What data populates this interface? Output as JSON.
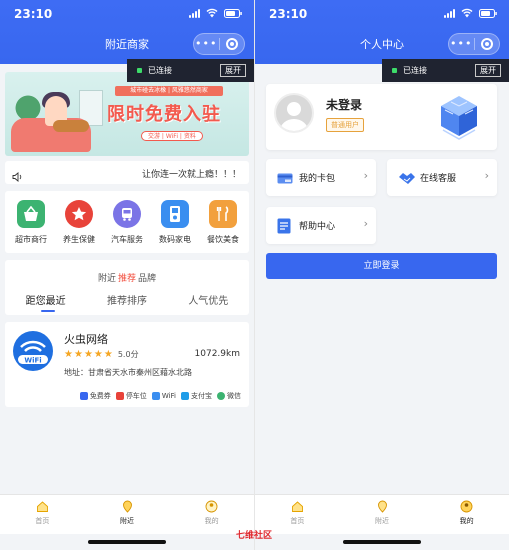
{
  "left": {
    "status_time": "23:10",
    "nav_title": "附近商家",
    "connection": {
      "text": "已连接",
      "expand": "展开"
    },
    "banner": {
      "ribbon": "城市碰去冰橡 | 风雅悠然商家",
      "title": "限时免费入驻",
      "tag": "交游 | WiFi | 资料"
    },
    "notice": "让你连一次就上瘾！！！",
    "categories": [
      {
        "label": "超市商行",
        "icon": "supermarket-icon",
        "color": "#3cb371"
      },
      {
        "label": "养生保健",
        "icon": "star-icon",
        "color": "#e8433a"
      },
      {
        "label": "汽车服务",
        "icon": "bus-icon",
        "color": "#7b74e6"
      },
      {
        "label": "数码家电",
        "icon": "appliance-icon",
        "color": "#3a8ef0"
      },
      {
        "label": "餐饮美食",
        "icon": "food-icon",
        "color": "#f2a03d"
      }
    ],
    "tabs": {
      "head_pre": "附近",
      "head_mid": "推荐",
      "head_post": "品牌",
      "items": [
        "距您最近",
        "推荐排序",
        "人气优先"
      ]
    },
    "merchant": {
      "name": "火虫网络",
      "score": "5.0分",
      "rating": 5,
      "distance": "1072.9km",
      "address": "地址：甘肃省天水市秦州区藉水北路",
      "logo_text": "WiFi",
      "tags": [
        "免费券",
        "停车位",
        "WiFi",
        "支付宝",
        "微信"
      ]
    },
    "bottom_nav": [
      "首页",
      "附近",
      "我的"
    ]
  },
  "right": {
    "status_time": "23:10",
    "nav_title": "个人中心",
    "connection": {
      "text": "已连接",
      "expand": "展开"
    },
    "profile": {
      "name": "未登录",
      "badge": "普通用户"
    },
    "cards": [
      {
        "label": "我的卡包",
        "icon": "vip-card-icon"
      },
      {
        "label": "在线客服",
        "icon": "handshake-icon"
      },
      {
        "label": "帮助中心",
        "icon": "document-icon"
      }
    ],
    "login_button": "立即登录",
    "bottom_nav": [
      "首页",
      "附近",
      "我的"
    ]
  },
  "watermark": "七维社区",
  "colors": {
    "primary": "#3867ef",
    "accent": "#f24b3b",
    "star": "#f5a623"
  }
}
